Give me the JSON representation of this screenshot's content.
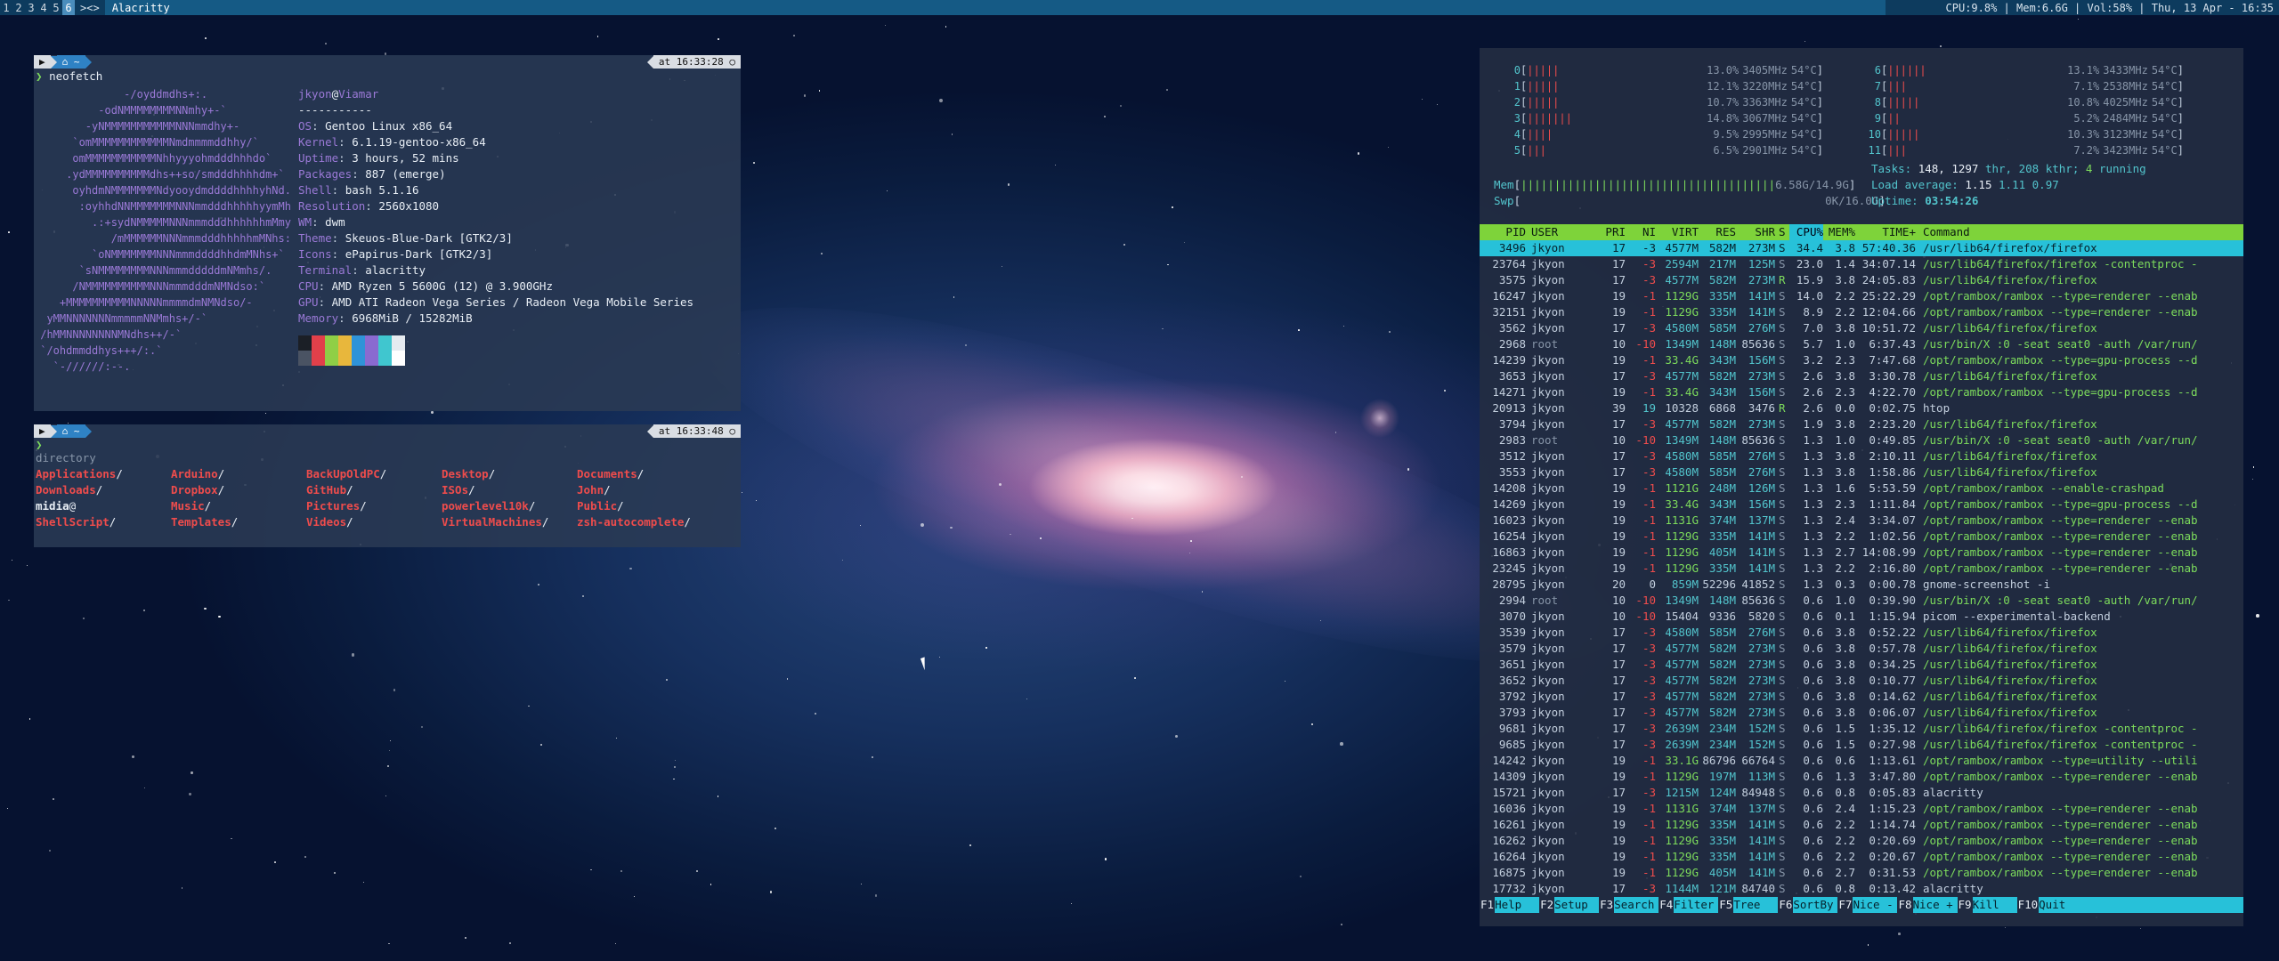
{
  "topbar": {
    "tags": [
      "1",
      "2",
      "3",
      "4",
      "5",
      "6"
    ],
    "selected_tag": "6",
    "layout": "><>",
    "window_title": "Alacritty",
    "status": "CPU:9.8% | Mem:6.6G | Vol:58% | Thu, 13 Apr - 16:35"
  },
  "term1": {
    "seg1": "▶",
    "seg2": "⌂ ~",
    "time": "at 16:33:28 ○",
    "prompt": "❯",
    "cmd": "neofetch",
    "logo": "              -/oyddmdhs+:.\n          -odNMMMMMMMMNNmhy+-`\n        -yNMMMMMMMMMMMNNNmmdhy+-\n      `omMMMMMMMMMMMMNmdmmmmddhhy/`\n      omMMMMMMMMMMMNhhyyyohmdddhhhdo`\n     .ydMMMMMMMMMMdhs++so/smdddhhhhdm+`\n      oyhdmNMMMMMMMNdyooydmddddhhhhyhNd.\n       :oyhhdNNMMMMMMMNNNmmdddhhhhhyymMh\n         .:+sydNMMMMMNNNmmmdddhhhhhhmMmy\n            /mMMMMMMNNNmmmdddhhhhhmMNhs:\n         `oNMMMMMMMNNNmmmddddhhdmMNhs+`\n       `sNMMMMMMMMNNNmmmdddddmNMmhs/.\n      /NMMMMMMMMMMNNNmmmdddmNMNdso:`\n    +MMMMMMMMMMNNNNNmmmmdmNMNdso/-\n  yMMNNNNNNNmmmmmNNMmhs+/-`\n /hMMNNNNNNNNMNdhs++/-`\n `/ohdmmddhys+++/:.`\n   `-//////:--.",
    "user": "jkyon",
    "at": "@",
    "host": "Viamar",
    "sep": "-----------",
    "info": [
      {
        "k": "OS",
        "v": "Gentoo Linux x86_64"
      },
      {
        "k": "Kernel",
        "v": "6.1.19-gentoo-x86_64"
      },
      {
        "k": "Uptime",
        "v": "3 hours, 52 mins"
      },
      {
        "k": "Packages",
        "v": "887 (emerge)"
      },
      {
        "k": "Shell",
        "v": "bash 5.1.16"
      },
      {
        "k": "Resolution",
        "v": "2560x1080"
      },
      {
        "k": "WM",
        "v": "dwm"
      },
      {
        "k": "Theme",
        "v": "Skeuos-Blue-Dark [GTK2/3]"
      },
      {
        "k": "Icons",
        "v": "ePapirus-Dark [GTK2/3]"
      },
      {
        "k": "Terminal",
        "v": "alacritty"
      },
      {
        "k": "CPU",
        "v": "AMD Ryzen 5 5600G (12) @ 3.900GHz"
      },
      {
        "k": "GPU",
        "v": "AMD ATI Radeon Vega Series / Radeon Vega Mobile Series"
      },
      {
        "k": "Memory",
        "v": "6968MiB / 15282MiB"
      }
    ],
    "swatch_top": [
      "#1b1f26",
      "#e2404a",
      "#8fcf46",
      "#e8b73c",
      "#2f93d8",
      "#8a6ad0",
      "#40c6cf",
      "#e6ebf0"
    ],
    "swatch_bottom": [
      "#4a5363",
      "#e2404a",
      "#8fcf46",
      "#e8b73c",
      "#2f93d8",
      "#8a6ad0",
      "#40c6cf",
      "#ffffff"
    ]
  },
  "term2": {
    "seg1": "▶",
    "seg2": "⌂ ~",
    "time": "at 16:33:48 ○",
    "prompt": "❯",
    "cmd": "directory",
    "entries": [
      {
        "n": "Applications",
        "s": "/",
        "t": "dir"
      },
      {
        "n": "Arduino",
        "s": "/",
        "t": "dir"
      },
      {
        "n": "BackUpOldPC",
        "s": "/",
        "t": "dir"
      },
      {
        "n": "Desktop",
        "s": "/",
        "t": "dir"
      },
      {
        "n": "Documents",
        "s": "/",
        "t": "dir"
      },
      {
        "n": "Downloads",
        "s": "/",
        "t": "dir"
      },
      {
        "n": "Dropbox",
        "s": "/",
        "t": "dir"
      },
      {
        "n": "GitHub",
        "s": "/",
        "t": "dir"
      },
      {
        "n": "ISOs",
        "s": "/",
        "t": "dir"
      },
      {
        "n": "John",
        "s": "/",
        "t": "dir"
      },
      {
        "n": "midia",
        "s": "@",
        "t": "link"
      },
      {
        "n": "Music",
        "s": "/",
        "t": "dir"
      },
      {
        "n": "Pictures",
        "s": "/",
        "t": "dir"
      },
      {
        "n": "powerlevel10k",
        "s": "/",
        "t": "dir"
      },
      {
        "n": "Public",
        "s": "/",
        "t": "dir"
      },
      {
        "n": "ShellScript",
        "s": "/",
        "t": "dir"
      },
      {
        "n": "Templates",
        "s": "/",
        "t": "dir"
      },
      {
        "n": "Videos",
        "s": "/",
        "t": "dir"
      },
      {
        "n": "VirtualMachines",
        "s": "/",
        "t": "dir"
      },
      {
        "n": "zsh-autocomplete",
        "s": "/",
        "t": "dir"
      }
    ]
  },
  "htop": {
    "cpus": [
      {
        "id": "0",
        "bar": "|||||",
        "pct": "13.0%",
        "mhz": "3405MHz",
        "temp": "54°C"
      },
      {
        "id": "1",
        "bar": "|||||",
        "pct": "12.1%",
        "mhz": "3220MHz",
        "temp": "54°C"
      },
      {
        "id": "2",
        "bar": "|||||",
        "pct": "10.7%",
        "mhz": "3363MHz",
        "temp": "54°C"
      },
      {
        "id": "3",
        "bar": "|||||||",
        "pct": "14.8%",
        "mhz": "3067MHz",
        "temp": "54°C"
      },
      {
        "id": "4",
        "bar": "||||",
        "pct": "9.5%",
        "mhz": "2995MHz",
        "temp": "54°C"
      },
      {
        "id": "5",
        "bar": "|||",
        "pct": "6.5%",
        "mhz": "2901MHz",
        "temp": "54°C"
      },
      {
        "id": "6",
        "bar": "||||||",
        "pct": "13.1%",
        "mhz": "3433MHz",
        "temp": "54°C"
      },
      {
        "id": "7",
        "bar": "|||",
        "pct": "7.1%",
        "mhz": "2538MHz",
        "temp": "54°C"
      },
      {
        "id": "8",
        "bar": "|||||",
        "pct": "10.8%",
        "mhz": "4025MHz",
        "temp": "54°C"
      },
      {
        "id": "9",
        "bar": "||",
        "pct": "5.2%",
        "mhz": "2484MHz",
        "temp": "54°C"
      },
      {
        "id": "10",
        "bar": "|||||",
        "pct": "10.3%",
        "mhz": "3123MHz",
        "temp": "54°C"
      },
      {
        "id": "11",
        "bar": "|||",
        "pct": "7.2%",
        "mhz": "3423MHz",
        "temp": "54°C"
      }
    ],
    "tasks_label": "Tasks:",
    "tasks": "148,",
    "thr": "1297",
    "thr_label": "thr,",
    "kthr": "208 kthr;",
    "running": "4",
    "running_label": "running",
    "mem_label": "Mem",
    "mem_bar": "||||||||||||||||||||||||||||||||||||||",
    "mem_val": "6.58G",
    "mem_total": "/14.9G",
    "swp_label": "Swp",
    "swp_val": "0K/16.0G",
    "load_label": "Load average:",
    "load1": "1.15",
    "load5": "1.11",
    "load15": "0.97",
    "uptime_label": "Uptime:",
    "uptime": "03:54:26",
    "columns": [
      "PID",
      "USER",
      "PRI",
      "NI",
      "VIRT",
      "RES",
      "SHR",
      "S",
      "CPU%",
      "MEM%",
      "TIME+",
      "Command"
    ],
    "rows": [
      [
        "3496",
        "jkyon",
        "17",
        "-3",
        "4577M",
        "582M",
        "273M",
        "S",
        "34.4",
        "3.8",
        "57:40.36",
        "/usr/lib64/firefox/firefox"
      ],
      [
        "23764",
        "jkyon",
        "17",
        "-3",
        "2594M",
        "217M",
        "125M",
        "S",
        "23.0",
        "1.4",
        "34:07.14",
        "/usr/lib64/firefox/firefox -contentproc -"
      ],
      [
        "3575",
        "jkyon",
        "17",
        "-3",
        "4577M",
        "582M",
        "273M",
        "R",
        "15.9",
        "3.8",
        "24:05.83",
        "/usr/lib64/firefox/firefox"
      ],
      [
        "16247",
        "jkyon",
        "19",
        "-1",
        "1129G",
        "335M",
        "141M",
        "S",
        "14.0",
        "2.2",
        "25:22.29",
        "/opt/rambox/rambox --type=renderer --enab"
      ],
      [
        "32151",
        "jkyon",
        "19",
        "-1",
        "1129G",
        "335M",
        "141M",
        "S",
        "8.9",
        "2.2",
        "12:04.66",
        "/opt/rambox/rambox --type=renderer --enab"
      ],
      [
        "3562",
        "jkyon",
        "17",
        "-3",
        "4580M",
        "585M",
        "276M",
        "S",
        "7.0",
        "3.8",
        "10:51.72",
        "/usr/lib64/firefox/firefox"
      ],
      [
        "2968",
        "root",
        "10",
        "-10",
        "1349M",
        "148M",
        "85636",
        "S",
        "5.7",
        "1.0",
        "6:37.43",
        "/usr/bin/X :0 -seat seat0 -auth /var/run/"
      ],
      [
        "14239",
        "jkyon",
        "19",
        "-1",
        "33.4G",
        "343M",
        "156M",
        "S",
        "3.2",
        "2.3",
        "7:47.68",
        "/opt/rambox/rambox --type=gpu-process --d"
      ],
      [
        "3653",
        "jkyon",
        "17",
        "-3",
        "4577M",
        "582M",
        "273M",
        "S",
        "2.6",
        "3.8",
        "3:30.78",
        "/usr/lib64/firefox/firefox"
      ],
      [
        "14271",
        "jkyon",
        "19",
        "-1",
        "33.4G",
        "343M",
        "156M",
        "S",
        "2.6",
        "2.3",
        "4:22.70",
        "/opt/rambox/rambox --type=gpu-process --d"
      ],
      [
        "20913",
        "jkyon",
        "39",
        "19",
        "10328",
        "6868",
        "3476",
        "R",
        "2.6",
        "0.0",
        "0:02.75",
        "htop"
      ],
      [
        "3794",
        "jkyon",
        "17",
        "-3",
        "4577M",
        "582M",
        "273M",
        "S",
        "1.9",
        "3.8",
        "2:23.20",
        "/usr/lib64/firefox/firefox"
      ],
      [
        "2983",
        "root",
        "10",
        "-10",
        "1349M",
        "148M",
        "85636",
        "S",
        "1.3",
        "1.0",
        "0:49.85",
        "/usr/bin/X :0 -seat seat0 -auth /var/run/"
      ],
      [
        "3512",
        "jkyon",
        "17",
        "-3",
        "4580M",
        "585M",
        "276M",
        "S",
        "1.3",
        "3.8",
        "2:10.11",
        "/usr/lib64/firefox/firefox"
      ],
      [
        "3553",
        "jkyon",
        "17",
        "-3",
        "4580M",
        "585M",
        "276M",
        "S",
        "1.3",
        "3.8",
        "1:58.86",
        "/usr/lib64/firefox/firefox"
      ],
      [
        "14208",
        "jkyon",
        "19",
        "-1",
        "1121G",
        "248M",
        "126M",
        "S",
        "1.3",
        "1.6",
        "5:53.59",
        "/opt/rambox/rambox --enable-crashpad"
      ],
      [
        "14269",
        "jkyon",
        "19",
        "-1",
        "33.4G",
        "343M",
        "156M",
        "S",
        "1.3",
        "2.3",
        "1:11.84",
        "/opt/rambox/rambox --type=gpu-process --d"
      ],
      [
        "16023",
        "jkyon",
        "19",
        "-1",
        "1131G",
        "374M",
        "137M",
        "S",
        "1.3",
        "2.4",
        "3:34.07",
        "/opt/rambox/rambox --type=renderer --enab"
      ],
      [
        "16254",
        "jkyon",
        "19",
        "-1",
        "1129G",
        "335M",
        "141M",
        "S",
        "1.3",
        "2.2",
        "1:02.56",
        "/opt/rambox/rambox --type=renderer --enab"
      ],
      [
        "16863",
        "jkyon",
        "19",
        "-1",
        "1129G",
        "405M",
        "141M",
        "S",
        "1.3",
        "2.7",
        "14:08.99",
        "/opt/rambox/rambox --type=renderer --enab"
      ],
      [
        "23245",
        "jkyon",
        "19",
        "-1",
        "1129G",
        "335M",
        "141M",
        "S",
        "1.3",
        "2.2",
        "2:16.80",
        "/opt/rambox/rambox --type=renderer --enab"
      ],
      [
        "28795",
        "jkyon",
        "20",
        "0",
        "859M",
        "52296",
        "41852",
        "S",
        "1.3",
        "0.3",
        "0:00.78",
        "gnome-screenshot -i"
      ],
      [
        "2994",
        "root",
        "10",
        "-10",
        "1349M",
        "148M",
        "85636",
        "S",
        "0.6",
        "1.0",
        "0:39.90",
        "/usr/bin/X :0 -seat seat0 -auth /var/run/"
      ],
      [
        "3070",
        "jkyon",
        "10",
        "-10",
        "15404",
        "9336",
        "5820",
        "S",
        "0.6",
        "0.1",
        "1:15.94",
        "picom --experimental-backend"
      ],
      [
        "3539",
        "jkyon",
        "17",
        "-3",
        "4580M",
        "585M",
        "276M",
        "S",
        "0.6",
        "3.8",
        "0:52.22",
        "/usr/lib64/firefox/firefox"
      ],
      [
        "3579",
        "jkyon",
        "17",
        "-3",
        "4577M",
        "582M",
        "273M",
        "S",
        "0.6",
        "3.8",
        "0:57.78",
        "/usr/lib64/firefox/firefox"
      ],
      [
        "3651",
        "jkyon",
        "17",
        "-3",
        "4577M",
        "582M",
        "273M",
        "S",
        "0.6",
        "3.8",
        "0:34.25",
        "/usr/lib64/firefox/firefox"
      ],
      [
        "3652",
        "jkyon",
        "17",
        "-3",
        "4577M",
        "582M",
        "273M",
        "S",
        "0.6",
        "3.8",
        "0:10.77",
        "/usr/lib64/firefox/firefox"
      ],
      [
        "3792",
        "jkyon",
        "17",
        "-3",
        "4577M",
        "582M",
        "273M",
        "S",
        "0.6",
        "3.8",
        "0:14.62",
        "/usr/lib64/firefox/firefox"
      ],
      [
        "3793",
        "jkyon",
        "17",
        "-3",
        "4577M",
        "582M",
        "273M",
        "S",
        "0.6",
        "3.8",
        "0:06.07",
        "/usr/lib64/firefox/firefox"
      ],
      [
        "9681",
        "jkyon",
        "17",
        "-3",
        "2639M",
        "234M",
        "152M",
        "S",
        "0.6",
        "1.5",
        "1:35.12",
        "/usr/lib64/firefox/firefox -contentproc -"
      ],
      [
        "9685",
        "jkyon",
        "17",
        "-3",
        "2639M",
        "234M",
        "152M",
        "S",
        "0.6",
        "1.5",
        "0:27.98",
        "/usr/lib64/firefox/firefox -contentproc -"
      ],
      [
        "14242",
        "jkyon",
        "19",
        "-1",
        "33.1G",
        "86796",
        "66764",
        "S",
        "0.6",
        "0.6",
        "1:13.61",
        "/opt/rambox/rambox --type=utility --utili"
      ],
      [
        "14309",
        "jkyon",
        "19",
        "-1",
        "1129G",
        "197M",
        "113M",
        "S",
        "0.6",
        "1.3",
        "3:47.80",
        "/opt/rambox/rambox --type=renderer --enab"
      ],
      [
        "15721",
        "jkyon",
        "17",
        "-3",
        "1215M",
        "124M",
        "84948",
        "S",
        "0.6",
        "0.8",
        "0:05.83",
        "alacritty"
      ],
      [
        "16036",
        "jkyon",
        "19",
        "-1",
        "1131G",
        "374M",
        "137M",
        "S",
        "0.6",
        "2.4",
        "1:15.23",
        "/opt/rambox/rambox --type=renderer --enab"
      ],
      [
        "16261",
        "jkyon",
        "19",
        "-1",
        "1129G",
        "335M",
        "141M",
        "S",
        "0.6",
        "2.2",
        "1:14.74",
        "/opt/rambox/rambox --type=renderer --enab"
      ],
      [
        "16262",
        "jkyon",
        "19",
        "-1",
        "1129G",
        "335M",
        "141M",
        "S",
        "0.6",
        "2.2",
        "0:20.69",
        "/opt/rambox/rambox --type=renderer --enab"
      ],
      [
        "16264",
        "jkyon",
        "19",
        "-1",
        "1129G",
        "335M",
        "141M",
        "S",
        "0.6",
        "2.2",
        "0:20.67",
        "/opt/rambox/rambox --type=renderer --enab"
      ],
      [
        "16875",
        "jkyon",
        "19",
        "-1",
        "1129G",
        "405M",
        "141M",
        "S",
        "0.6",
        "2.7",
        "0:31.53",
        "/opt/rambox/rambox --type=renderer --enab"
      ],
      [
        "17732",
        "jkyon",
        "17",
        "-3",
        "1144M",
        "121M",
        "84740",
        "S",
        "0.6",
        "0.8",
        "0:13.42",
        "alacritty"
      ]
    ],
    "fkeys": [
      {
        "k": "F1",
        "l": "Help"
      },
      {
        "k": "F2",
        "l": "Setup"
      },
      {
        "k": "F3",
        "l": "Search"
      },
      {
        "k": "F4",
        "l": "Filter"
      },
      {
        "k": "F5",
        "l": "Tree"
      },
      {
        "k": "F6",
        "l": "SortBy"
      },
      {
        "k": "F7",
        "l": "Nice -"
      },
      {
        "k": "F8",
        "l": "Nice +"
      },
      {
        "k": "F9",
        "l": "Kill"
      },
      {
        "k": "F10",
        "l": "Quit"
      }
    ],
    "colors": {
      "header": "#7ed33a",
      "select": "#27c1d9",
      "red": "#ee4c4c",
      "green": "#7ddc5c"
    }
  }
}
